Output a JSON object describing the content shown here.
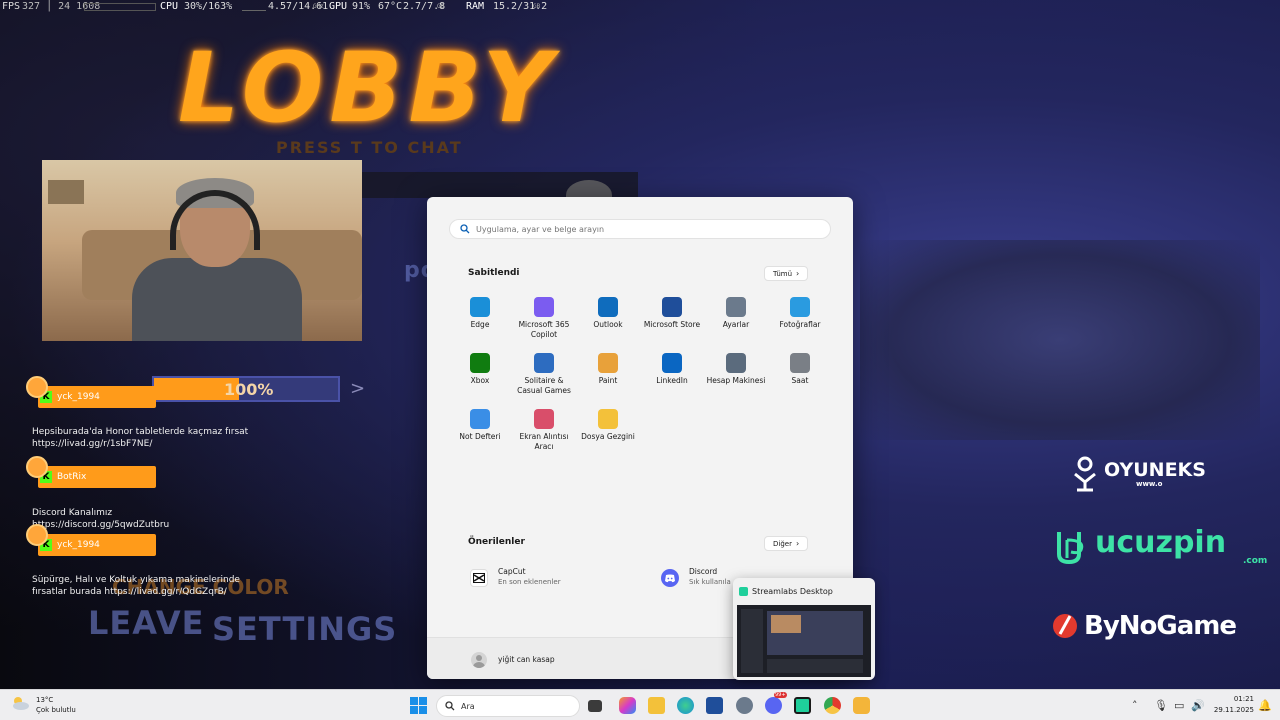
{
  "perf": {
    "fps_label": "FPS",
    "fps_values": "327 │ 24 1608",
    "cpu_label": "CPU",
    "cpu_values": "30%/163%",
    "cpu_extra": "4.57/14.61",
    "cpu_unit": "GHz",
    "gpu_label": "GPU",
    "gpu_values": "91%",
    "gpu_temp": "67°C",
    "gpu_mem": "2.7/7.8",
    "gpu_mem_unit": "GB",
    "ram_label": "RAM",
    "ram_values": "15.2/31.2",
    "ram_unit": "GB"
  },
  "game": {
    "title": "LOBBY",
    "hint": "PRESS T TO CHAT",
    "progress_value": 100,
    "progress_text": "100%",
    "arrow": ">",
    "ghost_left": "LEAVE",
    "ghost_right": "SETTINGS",
    "ghost_orange": "CHANGE COLOR",
    "ghost_po": "po"
  },
  "chat": [
    {
      "user": "yck_1994",
      "message": ""
    },
    {
      "user": "",
      "message": "Hepsiburada'da Honor tabletlerde kaçmaz fırsat https://livad.gg/r/1sbF7NE/"
    },
    {
      "user": "BotRix",
      "message": ""
    },
    {
      "user": "",
      "message": "Discord Kanalımız https://discord.gg/5qwdZutbru"
    },
    {
      "user": "yck_1994",
      "message": ""
    },
    {
      "user": "",
      "message": "Süpürge, Halı ve Koltuk yıkama makinelerinde fırsatlar burada https://livad.gg/r/QdGZqrB/"
    }
  ],
  "sponsors": {
    "s1_name": "OYUNEKS",
    "s1_sub": "www.o",
    "s2_name": "ucuzpin",
    "s2_sub": ".com",
    "s3_name": "ByNoGame"
  },
  "start_menu": {
    "search_placeholder": "Uygulama, ayar ve belge arayın",
    "pinned_title": "Sabitlendi",
    "all_button": "Tümü",
    "pinned": [
      {
        "label": "Edge",
        "icon": "edge-icon",
        "color": "#1a8fd8"
      },
      {
        "label": "Microsoft 365 Copilot",
        "icon": "m365-copilot-icon",
        "color": "#7b5cf0"
      },
      {
        "label": "Outlook",
        "icon": "outlook-icon",
        "color": "#0f6cbd"
      },
      {
        "label": "Microsoft Store",
        "icon": "store-icon",
        "color": "#1f4e9a"
      },
      {
        "label": "Ayarlar",
        "icon": "settings-gear-icon",
        "color": "#6b7a8c"
      },
      {
        "label": "Fotoğraflar",
        "icon": "photos-icon",
        "color": "#2a9be0"
      },
      {
        "label": "Xbox",
        "icon": "xbox-icon",
        "color": "#107c10"
      },
      {
        "label": "Solitaire & Casual Games",
        "icon": "solitaire-icon",
        "color": "#2d6cc0"
      },
      {
        "label": "Paint",
        "icon": "paint-icon",
        "color": "#e8a13a"
      },
      {
        "label": "LinkedIn",
        "icon": "linkedin-icon",
        "color": "#0a66c2"
      },
      {
        "label": "Hesap Makinesi",
        "icon": "calculator-icon",
        "color": "#5b6b7d"
      },
      {
        "label": "Saat",
        "icon": "clock-icon",
        "color": "#7a7f86"
      },
      {
        "label": "Not Defteri",
        "icon": "notepad-icon",
        "color": "#3a8ee6"
      },
      {
        "label": "Ekran Alıntısı Aracı",
        "icon": "snipping-tool-icon",
        "color": "#d94e6a"
      },
      {
        "label": "Dosya Gezgini",
        "icon": "file-explorer-icon",
        "color": "#f3c13a"
      }
    ],
    "recommended_title": "Önerilenler",
    "more_button": "Diğer",
    "recommended": [
      {
        "title": "CapCut",
        "subtitle": "En son eklenenler",
        "icon": "capcut-icon",
        "color": "#111111"
      },
      {
        "title": "Discord",
        "subtitle": "Sık kullanıla",
        "icon": "discord-icon",
        "color": "#5865f2"
      }
    ],
    "user_name": "yiğit can kasap"
  },
  "preview": {
    "title": "Streamlabs Desktop"
  },
  "taskbar": {
    "weather_temp": "13°C",
    "weather_desc": "Çok bulutlu",
    "search_label": "Ara",
    "time": "01:21",
    "date": "29.11.2025",
    "discord_badge": "99+"
  }
}
